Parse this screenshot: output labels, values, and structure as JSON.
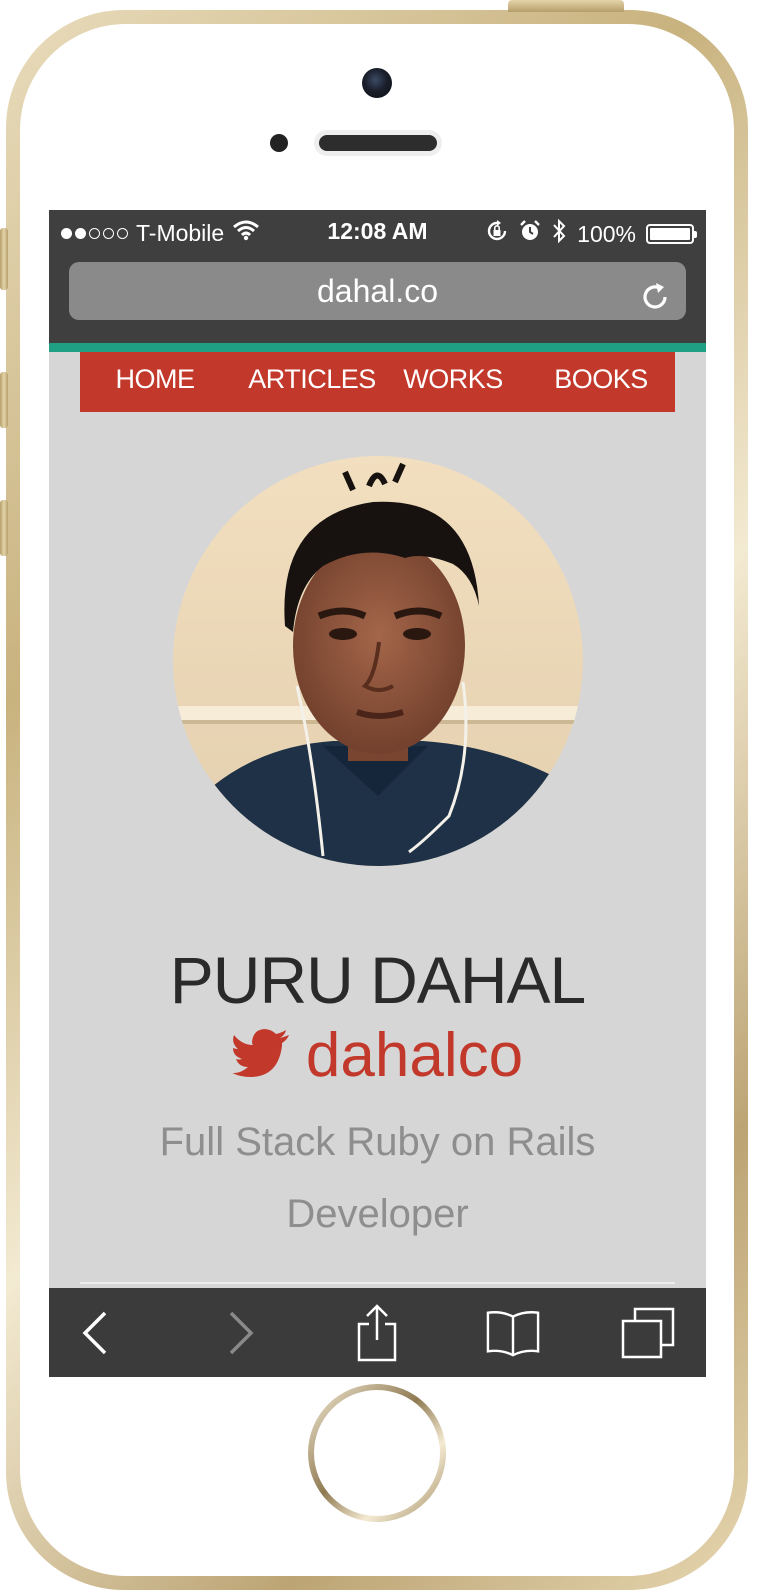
{
  "status_bar": {
    "carrier": "T-Mobile",
    "time": "12:08 AM",
    "battery": "100%"
  },
  "browser": {
    "url": "dahal.co"
  },
  "nav": {
    "items": [
      {
        "label": "HOME"
      },
      {
        "label": "ARTICLES"
      },
      {
        "label": "WORKS"
      },
      {
        "label": "BOOKS"
      }
    ]
  },
  "profile": {
    "name": "PURU DAHAL",
    "twitter_handle": "dahalco",
    "tagline_line1": "Full Stack Ruby on Rails",
    "tagline_line2": "Developer"
  },
  "icons": {
    "wifi": "wifi-icon",
    "rotation_lock": "rotation-lock-icon",
    "alarm": "alarm-icon",
    "bluetooth": "bluetooth-icon",
    "reload": "reload-icon",
    "twitter": "twitter-bird-icon",
    "back": "back-chevron-icon",
    "forward": "forward-chevron-icon",
    "share": "share-icon",
    "bookmarks": "bookmarks-icon",
    "tabs": "tabs-icon"
  },
  "colors": {
    "nav_red": "#c2392b",
    "accent_teal": "#1fa084",
    "browser_chrome": "#3f3f3f",
    "page_bg": "#d6d6d6"
  }
}
